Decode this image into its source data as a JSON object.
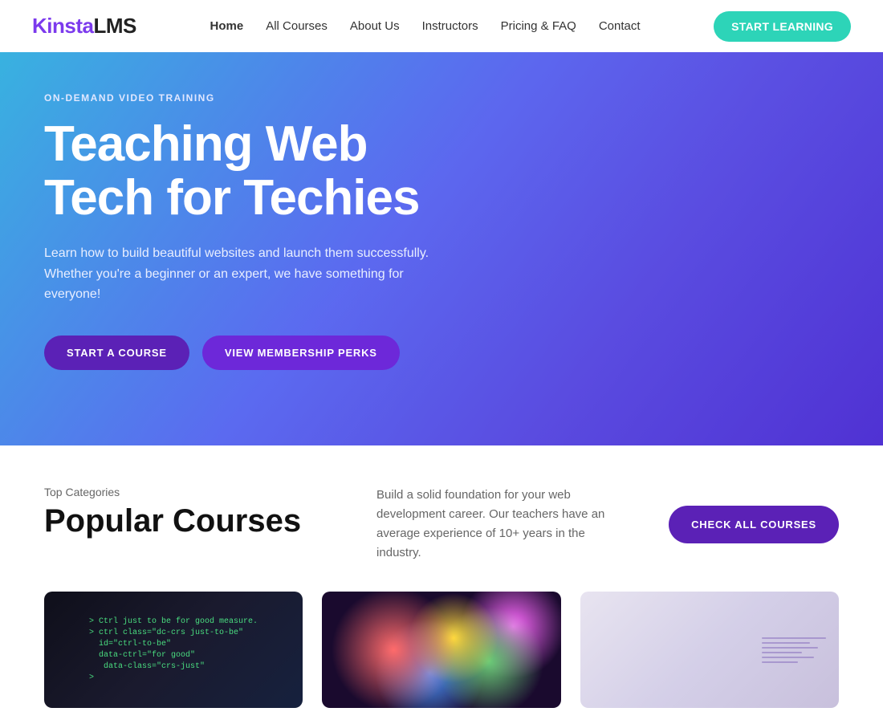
{
  "logo": {
    "kinsta": "Kinsta",
    "lms": "LMS"
  },
  "nav": {
    "links": [
      {
        "label": "Home",
        "active": true
      },
      {
        "label": "All Courses"
      },
      {
        "label": "About Us"
      },
      {
        "label": "Instructors"
      },
      {
        "label": "Pricing & FAQ"
      },
      {
        "label": "Contact"
      }
    ],
    "cta_label": "START LEARNING"
  },
  "hero": {
    "tag": "ON-DEMAND VIDEO TRAINING",
    "title_line1": "Teaching Web",
    "title_line2": "Tech for Techies",
    "subtitle": "Learn how to build beautiful websites and launch them successfully. Whether you're a beginner or an expert, we have something for everyone!",
    "btn_start": "START A COURSE",
    "btn_membership": "VIEW MEMBERSHIP PERKS"
  },
  "courses": {
    "top_label": "Top Categories",
    "title": "Popular Courses",
    "description": "Build a solid foundation for your web development career. Our teachers have an average experience of 10+ years in the industry.",
    "btn_check": "CHECK ALL COURSES",
    "code_snippet": "> Ctrl just to be for good measure.\n> ctrl class=\"dc-crs just-to-be\"\n  id=\"ctrl-to-be\"\n  data-ctrl=\"for good\"\n   data-class=\"crs-just\"\n>"
  }
}
